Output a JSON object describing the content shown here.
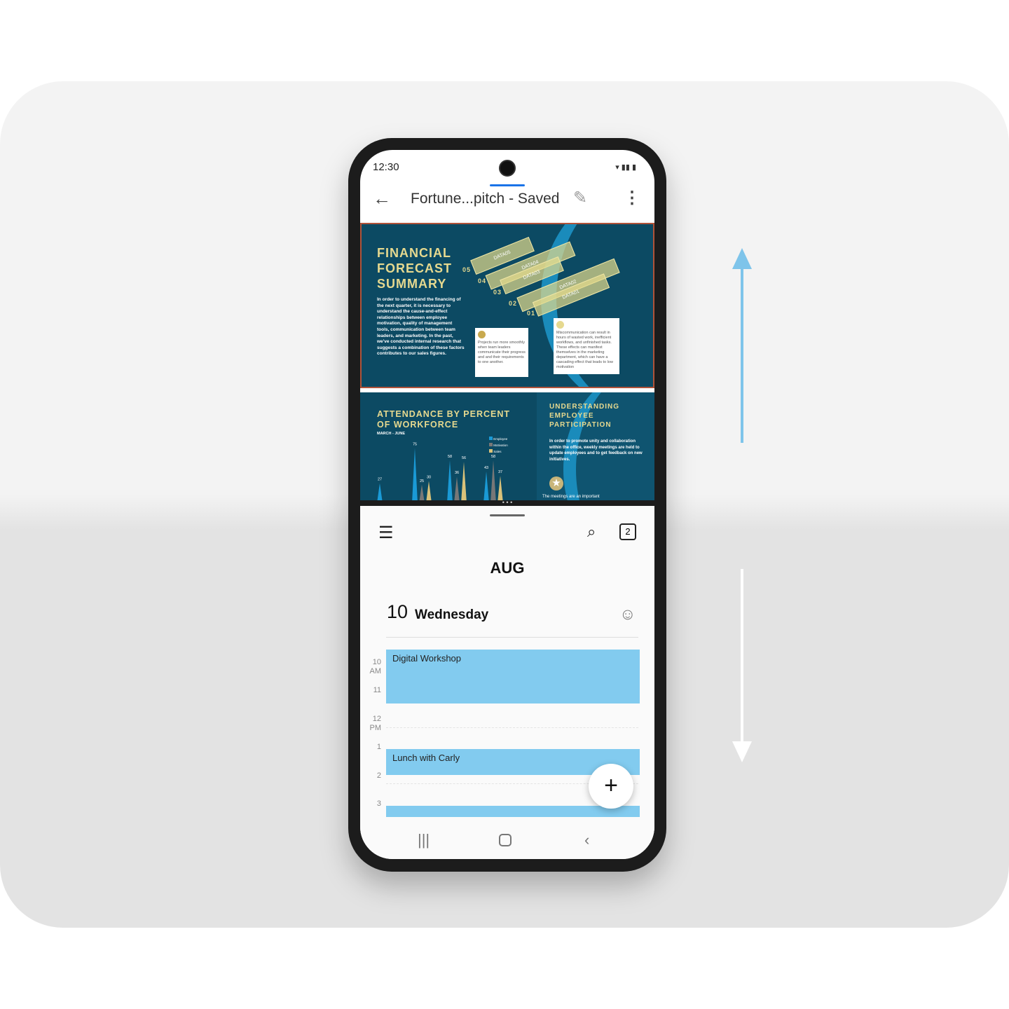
{
  "status": {
    "time": "12:30"
  },
  "header": {
    "title": "Fortune...pitch - Saved"
  },
  "slide1": {
    "title_lines": [
      "FINANCIAL",
      "FORECAST",
      "SUMMARY"
    ],
    "body": "In order to understand the financing of the next quarter, it is necessary to understand the cause-and-effect relationships between employee motivation, quality of management tools, communication between team leaders, and marketing. In the past, we've conducted internal research that suggests a combination of these factors contributes to our sales figures.",
    "bars": [
      "DATA05",
      "DATA04",
      "DATA03",
      "DATA02",
      "DATA01"
    ],
    "nums": [
      "05",
      "04",
      "03",
      "02",
      "01"
    ],
    "box1": "Projects run more smoothly when team leaders communicate their progress and and their requirements to one another.",
    "box2": "Miscommunication can result in hours of wasted work, inefficient workflows, and unfinished tasks. These effects can manifest themselves in the marketing department, which can have a cascading effect that leads to low motivation"
  },
  "slide2": {
    "title": "ATTENDANCE BY PERCENT OF WORKFORCE",
    "subtitle": "MARCH - JUNE",
    "legend": [
      "Employee",
      "Motivation",
      "Sales"
    ],
    "colors": [
      "#1a9ad6",
      "#777777",
      "#d9c27a"
    ],
    "values": [
      {
        "v": 27,
        "c": 0
      },
      {
        "v": 75,
        "c": 0
      },
      {
        "v": 25,
        "c": 1
      },
      {
        "v": 30,
        "c": 2
      },
      {
        "v": 58,
        "c": 0
      },
      {
        "v": 36,
        "c": 1
      },
      {
        "v": 56,
        "c": 2
      },
      {
        "v": 43,
        "c": 0
      },
      {
        "v": 58,
        "c": 1
      },
      {
        "v": 37,
        "c": 2
      }
    ],
    "right_title": "UNDERSTANDING EMPLOYEE PARTICIPATION",
    "right_body": "In order to promote unity and collaboration within the office, weekly meetings are held to update employees and to get feedback on new initiatives.",
    "right_footer": "The meetings are an important"
  },
  "calendar": {
    "month": "AUG",
    "day_num": "10",
    "day_name": "Wednesday",
    "badge": "2",
    "hours": [
      {
        "h": "10",
        "m": "AM"
      },
      {
        "h": "11",
        "m": ""
      },
      {
        "h": "12",
        "m": "PM"
      },
      {
        "h": "1",
        "m": ""
      },
      {
        "h": "2",
        "m": ""
      },
      {
        "h": "3",
        "m": ""
      }
    ],
    "events": [
      "Digital Workshop",
      "Lunch with Carly",
      ""
    ]
  },
  "colors": {
    "event": "#82cbef",
    "arrow_up": "#7ec4ea",
    "tab_indicator": "#1a73e8"
  }
}
